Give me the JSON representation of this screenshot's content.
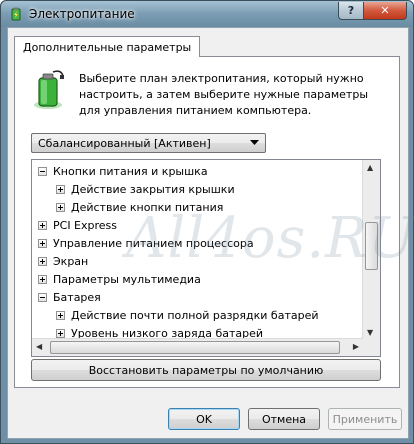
{
  "window": {
    "title": "Электропитание",
    "help_label": "?",
    "close_label": "✕"
  },
  "tab": {
    "label": "Дополнительные параметры"
  },
  "description": "Выберите план электропитания, который нужно настроить, а затем выберите нужные параметры для управления питанием компьютера.",
  "plan_select": {
    "value": "Сбалансированный [Активен]"
  },
  "tree": {
    "items": [
      {
        "label": "Кнопки питания и крышка",
        "level": 0,
        "expanded": true
      },
      {
        "label": "Действие закрытия крышки",
        "level": 1,
        "expanded": false
      },
      {
        "label": "Действие кнопки питания",
        "level": 1,
        "expanded": false
      },
      {
        "label": "PCI Express",
        "level": 0,
        "expanded": false
      },
      {
        "label": "Управление питанием процессора",
        "level": 0,
        "expanded": false
      },
      {
        "label": "Экран",
        "level": 0,
        "expanded": false
      },
      {
        "label": "Параметры мультимедиа",
        "level": 0,
        "expanded": false
      },
      {
        "label": "Батарея",
        "level": 0,
        "expanded": true
      },
      {
        "label": "Действие почти полной разрядки батарей",
        "level": 1,
        "expanded": false
      },
      {
        "label": "Уровень низкого заряда батарей",
        "level": 1,
        "expanded": false
      }
    ]
  },
  "buttons": {
    "restore": "Восстановить параметры по умолчанию",
    "ok": "OK",
    "cancel": "Отмена",
    "apply": "Применить"
  },
  "watermark": "All4os.RU",
  "icons": {
    "title": "battery-power-icon",
    "description": "battery-charging-icon",
    "dropdown": "chevron-down-icon",
    "scroll_up": "scroll-up-arrow-icon",
    "scroll_down": "scroll-down-arrow-icon",
    "scroll_left": "scroll-left-arrow-icon",
    "scroll_right": "scroll-right-arrow-icon"
  },
  "colors": {
    "titlebar": "#7d9fb5",
    "close_button": "#c2381b",
    "battery_green": "#3bb33b"
  }
}
